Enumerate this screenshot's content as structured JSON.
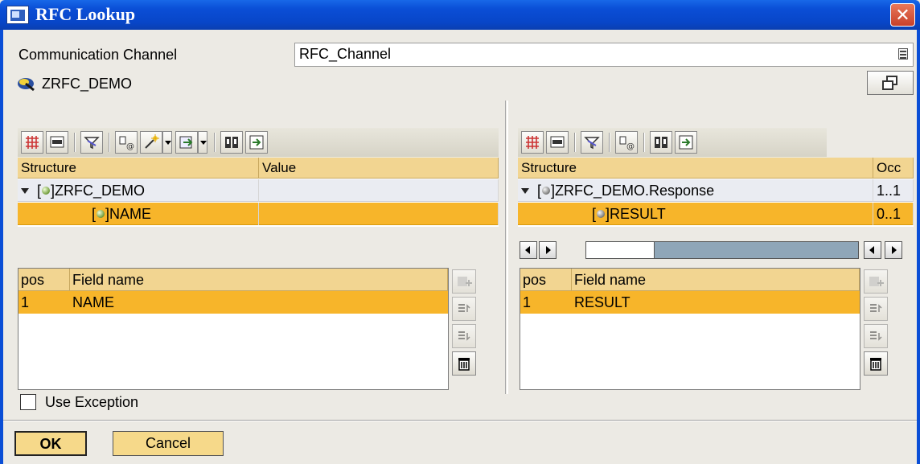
{
  "window": {
    "title": "RFC Lookup",
    "close_glyph": "✕"
  },
  "form": {
    "channel_label": "Communication Channel",
    "channel_value": "RFC_Channel",
    "function_name": "ZRFC_DEMO"
  },
  "left_panel": {
    "columns": [
      "Structure",
      "Value"
    ],
    "rows": [
      {
        "label": "ZRFC_DEMO",
        "value": ""
      },
      {
        "label": "NAME",
        "value": ""
      }
    ],
    "fields": {
      "headers": [
        "pos",
        "Field name"
      ],
      "rows": [
        {
          "pos": "1",
          "name": "NAME"
        }
      ]
    }
  },
  "right_panel": {
    "columns": [
      "Structure",
      "Occ"
    ],
    "rows": [
      {
        "label": "ZRFC_DEMO.Response",
        "occ": "1..1"
      },
      {
        "label": "RESULT",
        "occ": "0..1"
      }
    ],
    "fields": {
      "headers": [
        "pos",
        "Field name"
      ],
      "rows": [
        {
          "pos": "1",
          "name": "RESULT"
        }
      ]
    },
    "scroll_position": 0.2
  },
  "use_exception": {
    "label": "Use Exception",
    "checked": false
  },
  "buttons": {
    "ok": "OK",
    "cancel": "Cancel"
  },
  "colors": {
    "title_bar": "#0a4ed6",
    "header": "#f2d591",
    "selection": "#f7b52a",
    "button": "#f6d98a"
  }
}
